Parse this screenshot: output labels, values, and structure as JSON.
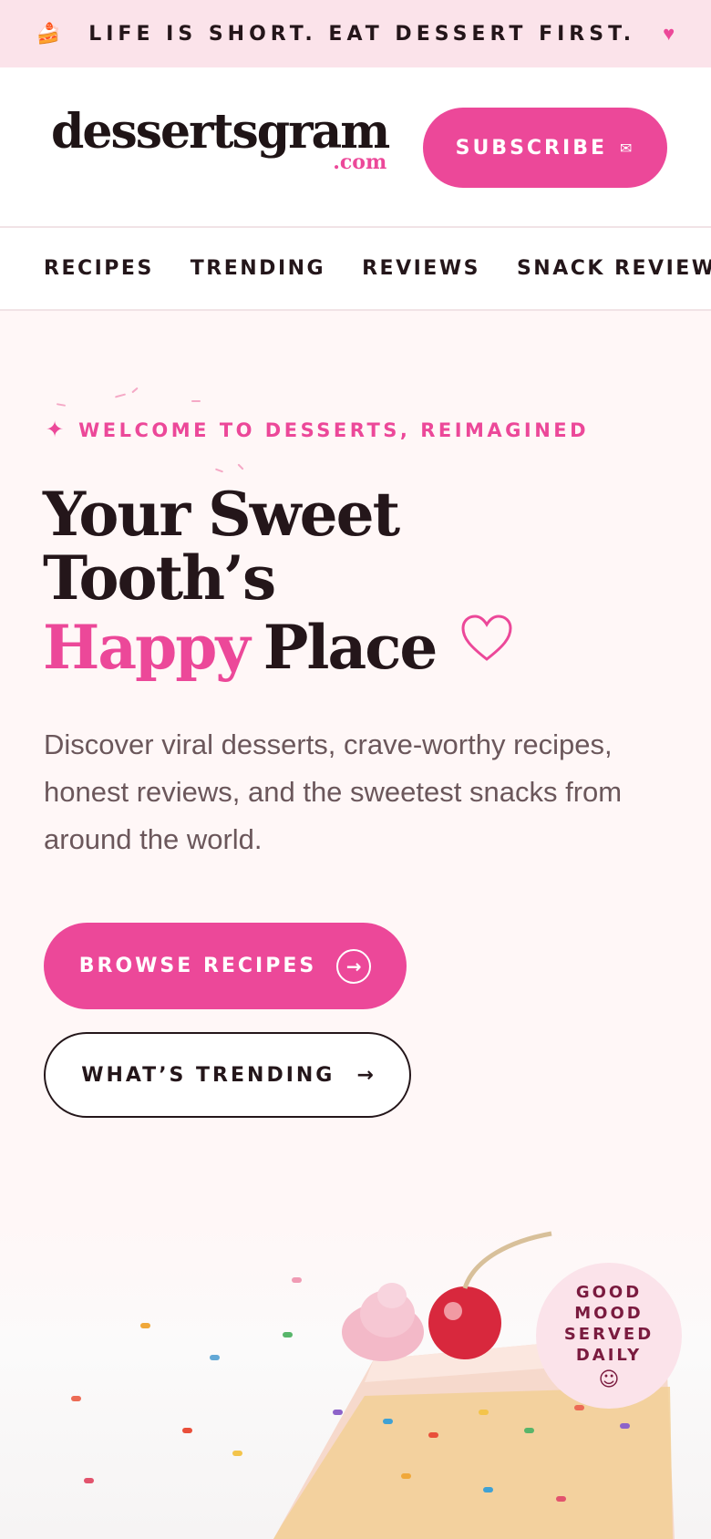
{
  "announcement": {
    "icon": "cake-slice-icon",
    "text": "LIFE IS SHORT. EAT DESSERT FIRST.",
    "heart_icon": "heart-icon"
  },
  "header": {
    "logo_word": "dessertsgram",
    "logo_suffix": ".com",
    "subscribe_label": "SUBSCRIBE",
    "subscribe_icon": "envelope-icon"
  },
  "nav": {
    "items": [
      {
        "label": "RECIPES"
      },
      {
        "label": "TRENDING"
      },
      {
        "label": "REVIEWS"
      },
      {
        "label": "SNACK REVIEWS"
      }
    ]
  },
  "hero": {
    "eyebrow": "WELCOME TO DESSERTS, REIMAGINED",
    "headline_line1": "Your Sweet",
    "headline_line2": "Tooth’s",
    "headline_highlight": "Happy",
    "headline_end": "Place",
    "lead": "Discover viral desserts, crave-worthy recipes, honest reviews, and the sweetest snacks from around the world.",
    "primary_cta": "BROWSE RECIPES",
    "secondary_cta": "WHAT’S TRENDING",
    "badge_lines": [
      "GOOD",
      "MOOD",
      "SERVED",
      "DAILY"
    ],
    "badge_icon": "smiley-icon"
  },
  "colors": {
    "accent": "#ec4899",
    "announcement_bg": "#fbe3ea",
    "text_dark": "#24161a",
    "text_muted": "#6b575b",
    "hero_bg": "#fff7f7"
  }
}
